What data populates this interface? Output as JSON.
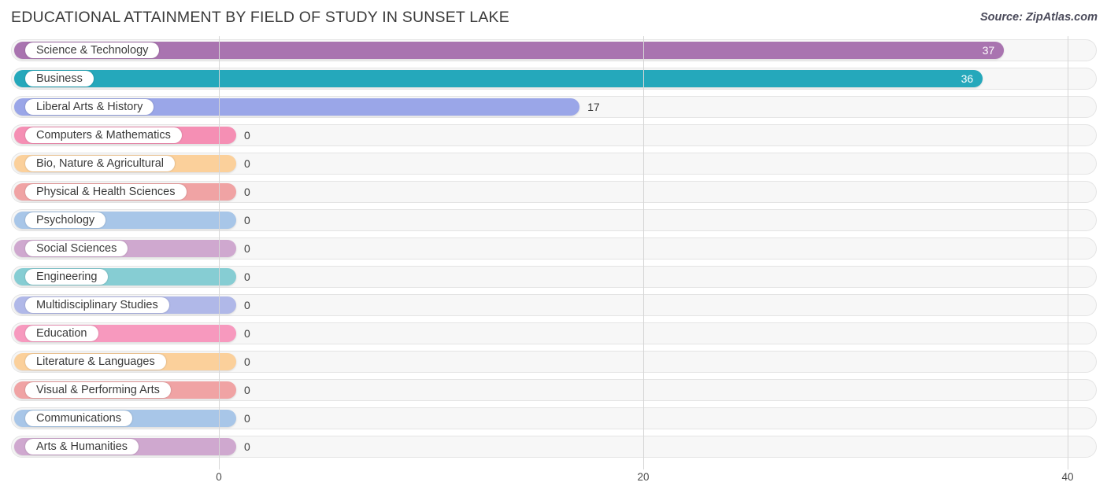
{
  "header": {
    "title": "EDUCATIONAL ATTAINMENT BY FIELD OF STUDY IN SUNSET LAKE",
    "source": "Source: ZipAtlas.com"
  },
  "chart_data": {
    "type": "bar",
    "orientation": "horizontal",
    "title": "EDUCATIONAL ATTAINMENT BY FIELD OF STUDY IN SUNSET LAKE",
    "xlabel": "",
    "ylabel": "",
    "xlim": [
      0,
      40
    ],
    "xticks": [
      0,
      20,
      40
    ],
    "xtick_labels": [
      "0",
      "20",
      "40"
    ],
    "grid": true,
    "legend": false,
    "categories": [
      "Science & Technology",
      "Business",
      "Liberal Arts & History",
      "Computers & Mathematics",
      "Bio, Nature & Agricultural",
      "Physical & Health Sciences",
      "Psychology",
      "Social Sciences",
      "Engineering",
      "Multidisciplinary Studies",
      "Education",
      "Literature & Languages",
      "Visual & Performing Arts",
      "Communications",
      "Arts & Humanities"
    ],
    "values": [
      37,
      36,
      17,
      0,
      0,
      0,
      0,
      0,
      0,
      0,
      0,
      0,
      0,
      0,
      0
    ],
    "value_labels": [
      "37",
      "36",
      "17",
      "0",
      "0",
      "0",
      "0",
      "0",
      "0",
      "0",
      "0",
      "0",
      "0",
      "0",
      "0"
    ],
    "colors": [
      "#a974b0",
      "#25a8bb",
      "#9aa6e8",
      "#f58fb4",
      "#fbd09b",
      "#f0a3a4",
      "#a8c6e8",
      "#cfa8cf",
      "#86cdd3",
      "#b0b8e8",
      "#f799be",
      "#fbd09b",
      "#f0a3a4",
      "#a8c6e8",
      "#cfa8cf"
    ]
  }
}
